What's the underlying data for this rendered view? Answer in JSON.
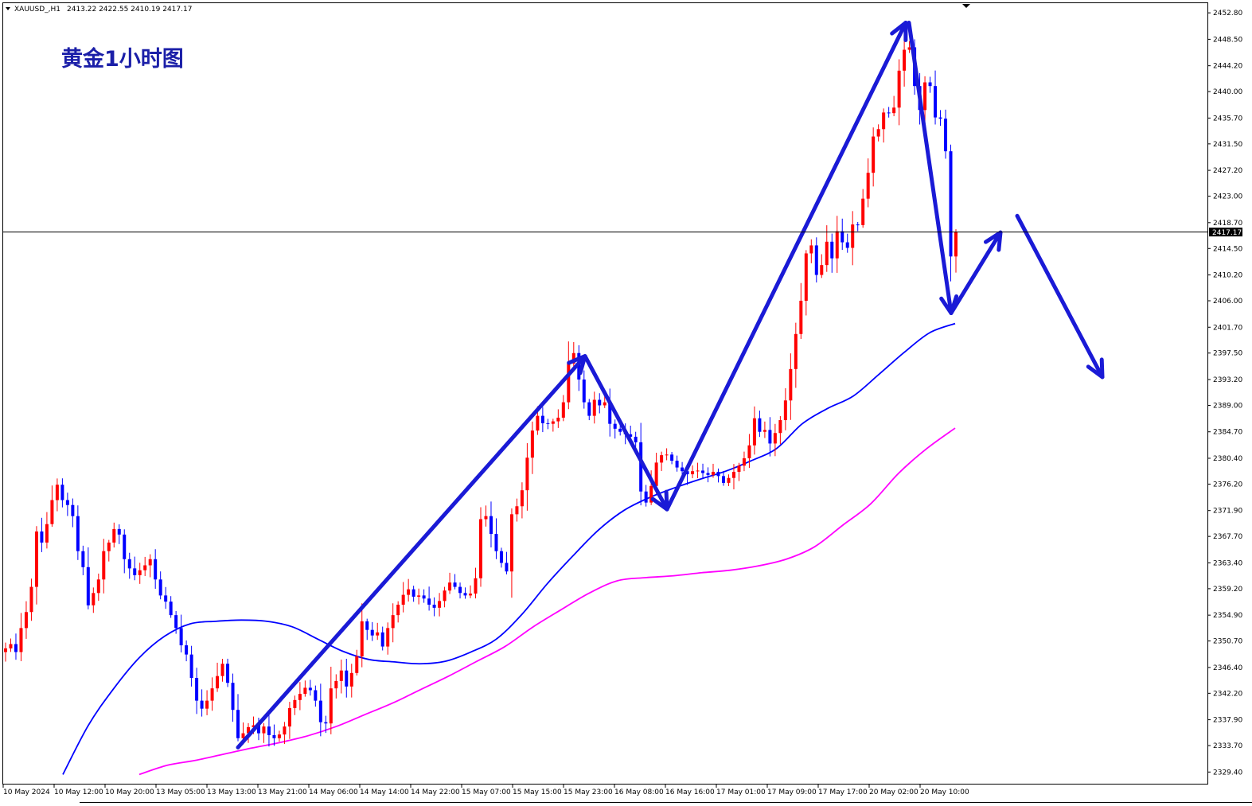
{
  "header": {
    "symbol": "XAUUSD_,H1",
    "ohlc": "2413.22 2422.55 2410.19 2417.17"
  },
  "title": "黄金1小时图",
  "current_price_label": "2417.17",
  "colors": {
    "bull": "#ff0000",
    "bear": "#0000ff",
    "ma_fast": "#0000ff",
    "ma_slow": "#ff00ff",
    "arrows": "#1a1ad6",
    "price_label_bg": "#000000"
  },
  "chart_data": {
    "type": "candlestick",
    "timeframe": "H1",
    "ylim": [
      2327.5,
      2454.5
    ],
    "grid": false,
    "y_ticks": [
      "2452.80",
      "2448.50",
      "2444.20",
      "2440.00",
      "2435.70",
      "2431.50",
      "2427.20",
      "2423.00",
      "2418.70",
      "2414.50",
      "2410.20",
      "2406.00",
      "2401.70",
      "2397.50",
      "2393.20",
      "2389.00",
      "2384.70",
      "2380.40",
      "2376.20",
      "2371.90",
      "2367.70",
      "2363.40",
      "2359.20",
      "2354.90",
      "2350.70",
      "2346.40",
      "2342.20",
      "2337.90",
      "2333.70",
      "2329.40"
    ],
    "x_ticks": [
      "10 May 2024",
      "10 May 12:00",
      "10 May 20:00",
      "13 May 05:00",
      "13 May 13:00",
      "13 May 21:00",
      "14 May 06:00",
      "14 May 14:00",
      "14 May 22:00",
      "15 May 07:00",
      "15 May 15:00",
      "15 May 23:00",
      "16 May 08:00",
      "16 May 16:00",
      "17 May 01:00",
      "17 May 09:00",
      "17 May 17:00",
      "20 May 02:00",
      "20 May 10:00"
    ],
    "current_price": 2417.17,
    "closes": [
      2349.5,
      2350.2,
      2348.9,
      2352.8,
      2355.4,
      2359.5,
      2368.5,
      2366.7,
      2369.7,
      2373.6,
      2376.1,
      2373.6,
      2372.8,
      2371.0,
      2365.3,
      2362.7,
      2356.5,
      2358.5,
      2360.7,
      2365.3,
      2366.7,
      2368.9,
      2368.0,
      2364.0,
      2362.5,
      2361.4,
      2362.2,
      2363.0,
      2364.0,
      2360.7,
      2358.1,
      2357.1,
      2354.9,
      2352.8,
      2350.0,
      2348.5,
      2344.7,
      2341.0,
      2339.7,
      2341.0,
      2343.0,
      2345.0,
      2347.0,
      2343.9,
      2339.5,
      2334.9,
      2335.7,
      2336.7,
      2337.0,
      2335.7,
      2336.8,
      2335.4,
      2334.9,
      2335.5,
      2336.8,
      2339.8,
      2341.1,
      2342.1,
      2343.1,
      2342.7,
      2341.0,
      2337.5,
      2337.3,
      2343.0,
      2344.2,
      2345.9,
      2343.3,
      2345.5,
      2348.2,
      2353.9,
      2352.5,
      2351.6,
      2352.1,
      2349.8,
      2352.8,
      2354.9,
      2356.6,
      2358.2,
      2359.1,
      2357.9,
      2358.1,
      2357.6,
      2356.6,
      2356.1,
      2357.2,
      2358.9,
      2360.2,
      2359.5,
      2358.5,
      2358.1,
      2358.4,
      2360.9,
      2370.5,
      2371.0,
      2368.1,
      2365.3,
      2363.4,
      2362.0,
      2371.3,
      2372.6,
      2375.2,
      2380.5,
      2384.9,
      2387.3,
      2386.1,
      2386.0,
      2386.4,
      2387.0,
      2389.5,
      2395.8,
      2397.5,
      2393.2,
      2389.5,
      2387.3,
      2389.9,
      2389.0,
      2389.5,
      2386.0,
      2385.2,
      2384.7,
      2384.3,
      2383.9,
      2383.0,
      2375.0,
      2373.2,
      2375.9,
      2379.7,
      2380.9,
      2381.0,
      2380.0,
      2378.9,
      2378.3,
      2377.8,
      2378.3,
      2378.4,
      2378.0,
      2377.7,
      2378.2,
      2377.5,
      2376.4,
      2377.2,
      2378.2,
      2379.2,
      2380.4,
      2382.5,
      2386.9,
      2384.7,
      2385.0,
      2382.8,
      2384.5,
      2386.6,
      2389.8,
      2394.9,
      2400.6,
      2406.0,
      2413.7,
      2415.0,
      2410.2,
      2411.8,
      2415.6,
      2412.9,
      2417.3,
      2415.5,
      2414.6,
      2418.4,
      2418.3,
      2422.6,
      2426.8,
      2432.7,
      2433.9,
      2436.6,
      2436.5,
      2437.4,
      2443.4,
      2446.8,
      2447.2,
      2440.9,
      2437.0,
      2441.5,
      2440.9,
      2435.8,
      2435.6,
      2430.3,
      2413.2,
      2417.2
    ],
    "ma_fast": {
      "name": "",
      "x_range": [
        79,
        1200
      ],
      "values": [
        2329.0,
        2337.0,
        2343.0,
        2348.0,
        2351.5,
        2353.5,
        2353.9,
        2354.1,
        2353.9,
        2353.0,
        2351.0,
        2349.0,
        2347.7,
        2347.3,
        2347.0,
        2347.4,
        2348.9,
        2351.0,
        2355.0,
        2360.0,
        2364.5,
        2368.7,
        2371.9,
        2374.0,
        2375.6,
        2377.0,
        2378.3,
        2380.0,
        2382.0,
        2386.0,
        2388.5,
        2390.5,
        2394.0,
        2397.6,
        2400.8,
        2402.3
      ]
    },
    "ma_slow": {
      "name": "",
      "x_range": [
        175,
        1200
      ],
      "values": [
        2329.0,
        2330.5,
        2331.3,
        2332.3,
        2333.3,
        2334.2,
        2335.3,
        2336.8,
        2338.7,
        2340.6,
        2342.8,
        2345.0,
        2347.4,
        2349.8,
        2353.0,
        2355.8,
        2358.5,
        2360.5,
        2361.0,
        2361.3,
        2361.8,
        2362.2,
        2362.9,
        2364.0,
        2366.0,
        2369.5,
        2373.0,
        2378.0,
        2382.0,
        2385.3
      ]
    },
    "drawn_arrows": [
      {
        "from": [
          299,
          2333.4
        ],
        "to": [
          735,
          2397.0
        ]
      },
      {
        "from": [
          735,
          2397.0
        ],
        "to": [
          838,
          2372.1
        ]
      },
      {
        "from": [
          838,
          2372.1
        ],
        "to": [
          1138,
          2451.2
        ]
      },
      {
        "from": [
          1142,
          2451.2
        ],
        "to": [
          1195,
          2404.0
        ]
      },
      {
        "from": [
          1195,
          2404.0
        ],
        "to": [
          1257,
          2417.1
        ]
      },
      {
        "from": [
          1278,
          2419.8
        ],
        "to": [
          1385,
          2393.6
        ]
      }
    ]
  }
}
